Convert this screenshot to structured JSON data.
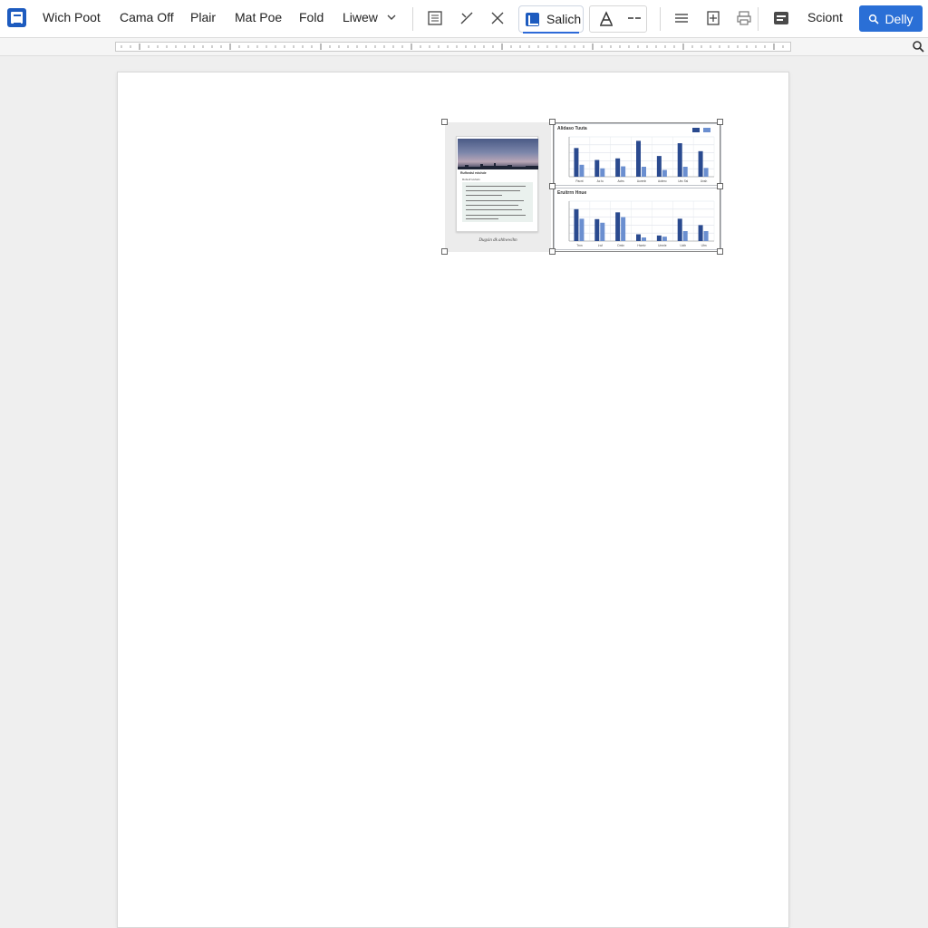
{
  "toolbar": {
    "menu": [
      "Wich Poot",
      "Cama Off",
      "Plair",
      "Mat Poe",
      "Fold",
      "Liwew"
    ],
    "insert_label": "Salich",
    "sciont_label": "Sciont",
    "primary_button_label": "Delly",
    "accent_color": "#2a6fd6",
    "icons": [
      "app-logo-icon",
      "chevron-down-icon",
      "table-icon",
      "cross-icon",
      "close-icon",
      "chart-insert-icon",
      "text-style-icon",
      "dash-icon",
      "align-icon",
      "add-box-icon",
      "print-icon",
      "comment-icon",
      "search-icon"
    ]
  },
  "ruler": {
    "icons": [
      "search-icon"
    ]
  },
  "document": {
    "figure": {
      "thumbnail": {
        "title": "Rufhedsl rvtchde",
        "subtitle": "Rufsolf tvufsdn",
        "caption": "Dugsin dk ahhwwihn"
      },
      "charts": [
        {
          "title": "Alidaso Tuuta",
          "chart_data": {
            "type": "bar",
            "categories": [
              "Pacnt",
              "Ac tu",
              "Actrs",
              "Aurenh",
              "Aclrmc",
              "Uec Ssl",
              "Unsh"
            ],
            "series": [
              {
                "name": "",
                "values": [
                  72,
                  42,
                  46,
                  90,
                  52,
                  84,
                  64
                ],
                "color": "#2a4a8f"
              },
              {
                "name": "",
                "values": [
                  30,
                  21,
                  26,
                  25,
                  17,
                  25,
                  22
                ],
                "color": "#6b8fd0"
              }
            ],
            "ylim": [
              0,
              100
            ]
          }
        },
        {
          "title": "Eruitrrn Hnue",
          "chart_data": {
            "type": "bar",
            "categories": [
              "Trnn",
              "Lwf",
              "Dmln",
              "Hwrrtv",
              "Unrnle",
              "Ucth",
              "Ufm"
            ],
            "series": [
              {
                "name": "",
                "values": [
                  80,
                  55,
                  72,
                  17,
                  14,
                  56,
                  40
                ],
                "color": "#2a4a8f"
              },
              {
                "name": "",
                "values": [
                  56,
                  46,
                  60,
                  9,
                  11,
                  25,
                  25
                ],
                "color": "#6b8fd0"
              }
            ],
            "ylim": [
              0,
              100
            ]
          }
        }
      ]
    }
  }
}
